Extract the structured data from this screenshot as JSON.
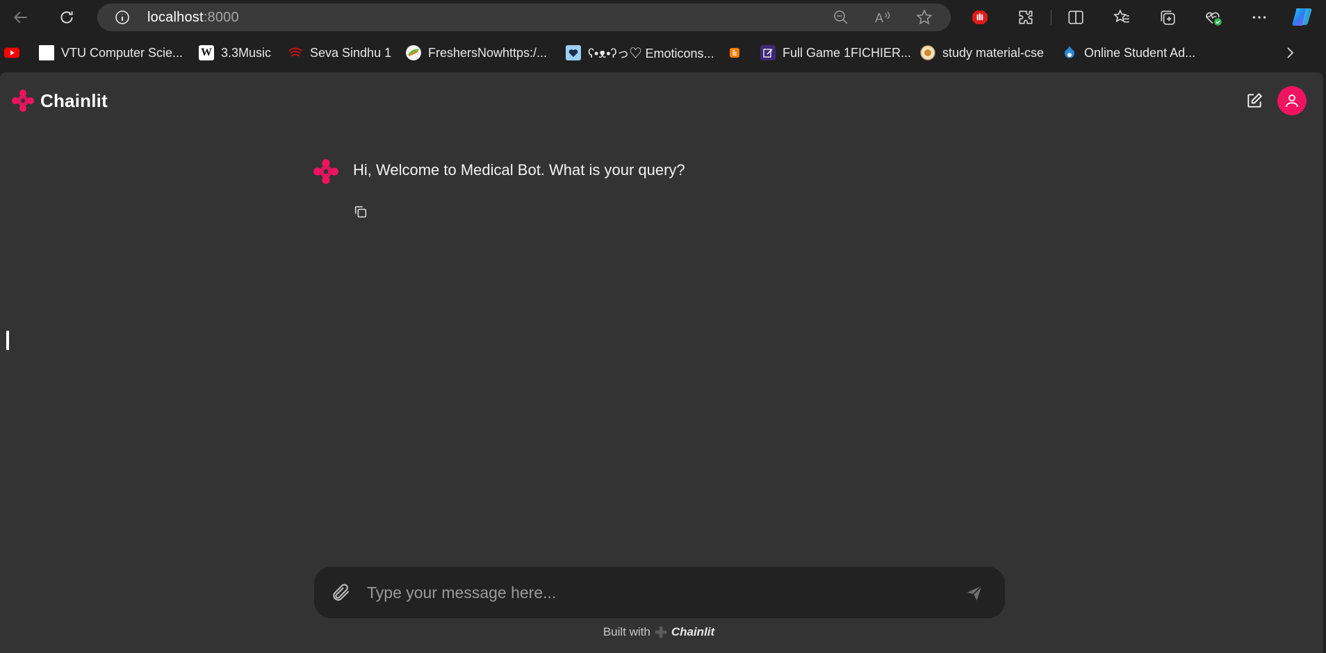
{
  "browser": {
    "address": {
      "host": "localhost",
      "port": ":8000"
    },
    "bookmarks": [
      {
        "label": "",
        "icon": "youtube-icon",
        "color": "#ff0000"
      },
      {
        "label": "VTU Computer Scie...",
        "icon": "blank-page-icon",
        "color": "#ffffff"
      },
      {
        "label": "3.3Music",
        "icon": "wikipedia-icon",
        "color": "#ffffff"
      },
      {
        "label": "Seva Sindhu 1",
        "icon": "seva-sindhu-icon",
        "color": "#d01010"
      },
      {
        "label": "FreshersNowhttps:/...",
        "icon": "freshersnow-icon",
        "color": "#f2f2f2"
      },
      {
        "label": "ʕ•ᴥ•ʔっ♡ Emoticons...",
        "icon": "heart-icon",
        "color": "#9bd0f5"
      },
      {
        "label": "",
        "icon": "blogger-icon",
        "color": "#f57d00"
      },
      {
        "label": "Full Game 1FICHIER...",
        "icon": "edit-doc-icon",
        "color": "#3c2a74"
      },
      {
        "label": "study material-cse",
        "icon": "college-seal-icon",
        "color": "#c7a26b"
      },
      {
        "label": "Online Student Ad...",
        "icon": "drupal-icon",
        "color": "#2a8ad8"
      }
    ]
  },
  "app": {
    "brand": "Chainlit",
    "accent": "#f0135f",
    "message": "Hi, Welcome to Medical Bot. What is your query?",
    "composer": {
      "placeholder": "Type your message here..."
    },
    "footer": {
      "prefix": "Built with",
      "brand": "Chainlit"
    }
  }
}
